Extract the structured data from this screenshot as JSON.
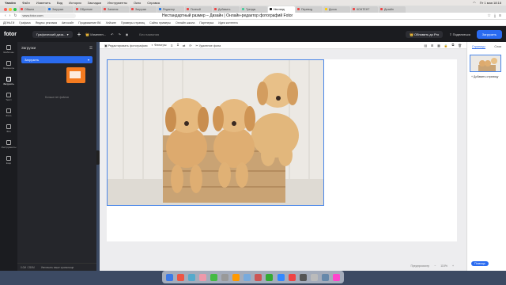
{
  "macos_menubar": {
    "app": "Yandex",
    "items": [
      "Файл",
      "Изменить",
      "Вид",
      "История",
      "Закладки",
      "Инструменты",
      "Окно",
      "Справка"
    ],
    "clock": "Пт 1 мая 18:18"
  },
  "browser_tabs": [
    {
      "label": "Обжиги",
      "color": "#e44"
    },
    {
      "label": "Загрузка",
      "color": "#1a73e8"
    },
    {
      "label": "Обучение",
      "color": "#e44"
    },
    {
      "label": "Занятия",
      "color": "#e44"
    },
    {
      "label": "Загрузки",
      "color": "#e44"
    },
    {
      "label": "Редактор",
      "color": "#1a73e8"
    },
    {
      "label": "Полный",
      "color": "#e44"
    },
    {
      "label": "Добавить",
      "color": "#e44"
    },
    {
      "label": "Тренды",
      "color": "#4c9"
    },
    {
      "label": "Нестанд",
      "color": "#111",
      "active": true
    },
    {
      "label": "Перевод",
      "color": "#e44"
    },
    {
      "label": "Доска",
      "color": "#fc0"
    },
    {
      "label": "КОНТЕНТ",
      "color": "#e44"
    },
    {
      "label": "Дизайн",
      "color": "#e44"
    }
  ],
  "addressbar": {
    "url": "www.fotor.com",
    "page_title": "Нестандартный размер – Дизайн | Онлайн-редактор фотографий Fotor"
  },
  "bookmarks": [
    "ДЕНЬГИ",
    "Графика",
    "Яндекс реклама",
    "Автосайт",
    "Продвижение ВК",
    "Хейзинг",
    "Примеры страниц",
    "Сайты примеры",
    "Онлайн школа",
    "Партнерка",
    "Идеи контента"
  ],
  "topbar": {
    "logo": "fotor",
    "mode_dropdown": "Графический диза...",
    "resize": "Изменен...",
    "title_placeholder": "Без названия",
    "pro_button": "Обновить до Pro",
    "share_button": "Поделиться",
    "upload_button": "Загрузить"
  },
  "sidebar": [
    {
      "label": "Шаблоны",
      "active": false
    },
    {
      "label": "Элементы",
      "active": false
    },
    {
      "label": "Загрузить",
      "active": true
    },
    {
      "label": "Текст",
      "active": false
    },
    {
      "label": "Фото",
      "active": false
    },
    {
      "label": "Фон",
      "active": false
    },
    {
      "label": "Инструменты",
      "active": false
    },
    {
      "label": "Ещё",
      "active": false
    }
  ],
  "panel": {
    "title": "Загрузки",
    "upload_button": "Загрузить",
    "hint": "Больше нет файлов",
    "footer_storage": "0.0M / 250M",
    "footer_link": "Увеличить ваше хранилище"
  },
  "workspace_toolbar": {
    "edit_photo": "Редактировать фотографию",
    "filters": "Фильтры",
    "remove_bg": "Удаление фона"
  },
  "workspace": {
    "preview": "Предпросмотр",
    "zoom": "115%"
  },
  "pages": {
    "tab_pages": "Страницы",
    "tab_layers": "Слои",
    "add_page": "+ Добавить страницу"
  },
  "help_button": "Помощь",
  "dock_apps": [
    "#3c7ae6",
    "#e54",
    "#5ac",
    "#e9a",
    "#4b4",
    "#999",
    "#f90",
    "#7ad",
    "#c55",
    "#3a3",
    "#38f",
    "#e44",
    "#555",
    "#bbb",
    "#68a",
    "#f4c"
  ]
}
